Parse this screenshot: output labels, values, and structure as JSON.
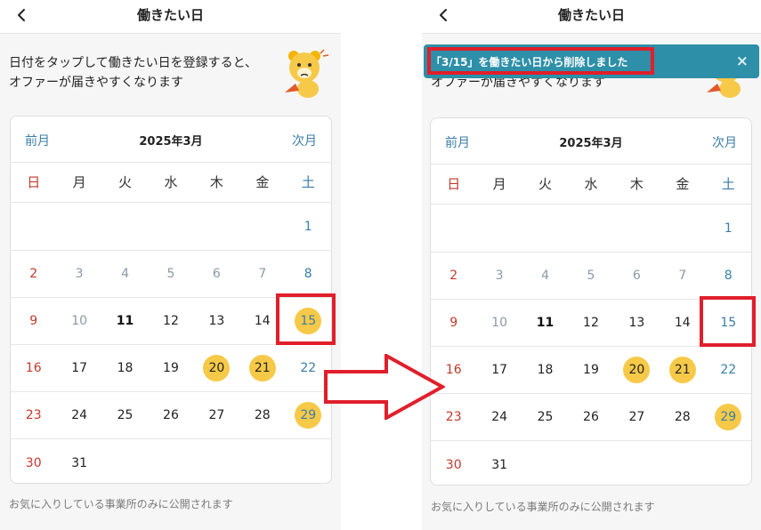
{
  "screen_title": "働きたい日",
  "intro_lines": [
    "日付をタップして働きたい日を登録すると、",
    "オファーが届きやすくなります"
  ],
  "month_label": "2025年3月",
  "prev_label": "前月",
  "next_label": "次月",
  "weekdays": [
    "日",
    "月",
    "火",
    "水",
    "木",
    "金",
    "土"
  ],
  "footer_note": "お気に入りしている事業所のみに公開されます",
  "toast_message": "「3/15」を働きたい日から削除しました",
  "toast_close": "×",
  "weeks": [
    [
      "",
      "",
      "",
      "",
      "",
      "",
      "1"
    ],
    [
      "2",
      "3",
      "4",
      "5",
      "6",
      "7",
      "8"
    ],
    [
      "9",
      "10",
      "11",
      "12",
      "13",
      "14",
      "15"
    ],
    [
      "16",
      "17",
      "18",
      "19",
      "20",
      "21",
      "22"
    ],
    [
      "23",
      "24",
      "25",
      "26",
      "27",
      "28",
      "29"
    ],
    [
      "30",
      "31",
      "",
      "",
      "",
      "",
      ""
    ]
  ],
  "today": "11",
  "past_days": [
    "3",
    "4",
    "5",
    "6",
    "7",
    "10"
  ],
  "selected_before": [
    "15",
    "20",
    "21",
    "29"
  ],
  "selected_after": [
    "20",
    "21",
    "29"
  ],
  "colors": {
    "selected_fill": "#f7c948",
    "sunday": "#c0392b",
    "saturday": "#3a7ea6",
    "toast_bg": "#2d8fa8",
    "highlight": "#e01f2b"
  },
  "icons": [
    "back-chevron-icon",
    "mascot-bear-icon",
    "close-icon",
    "right-arrow-icon"
  ]
}
